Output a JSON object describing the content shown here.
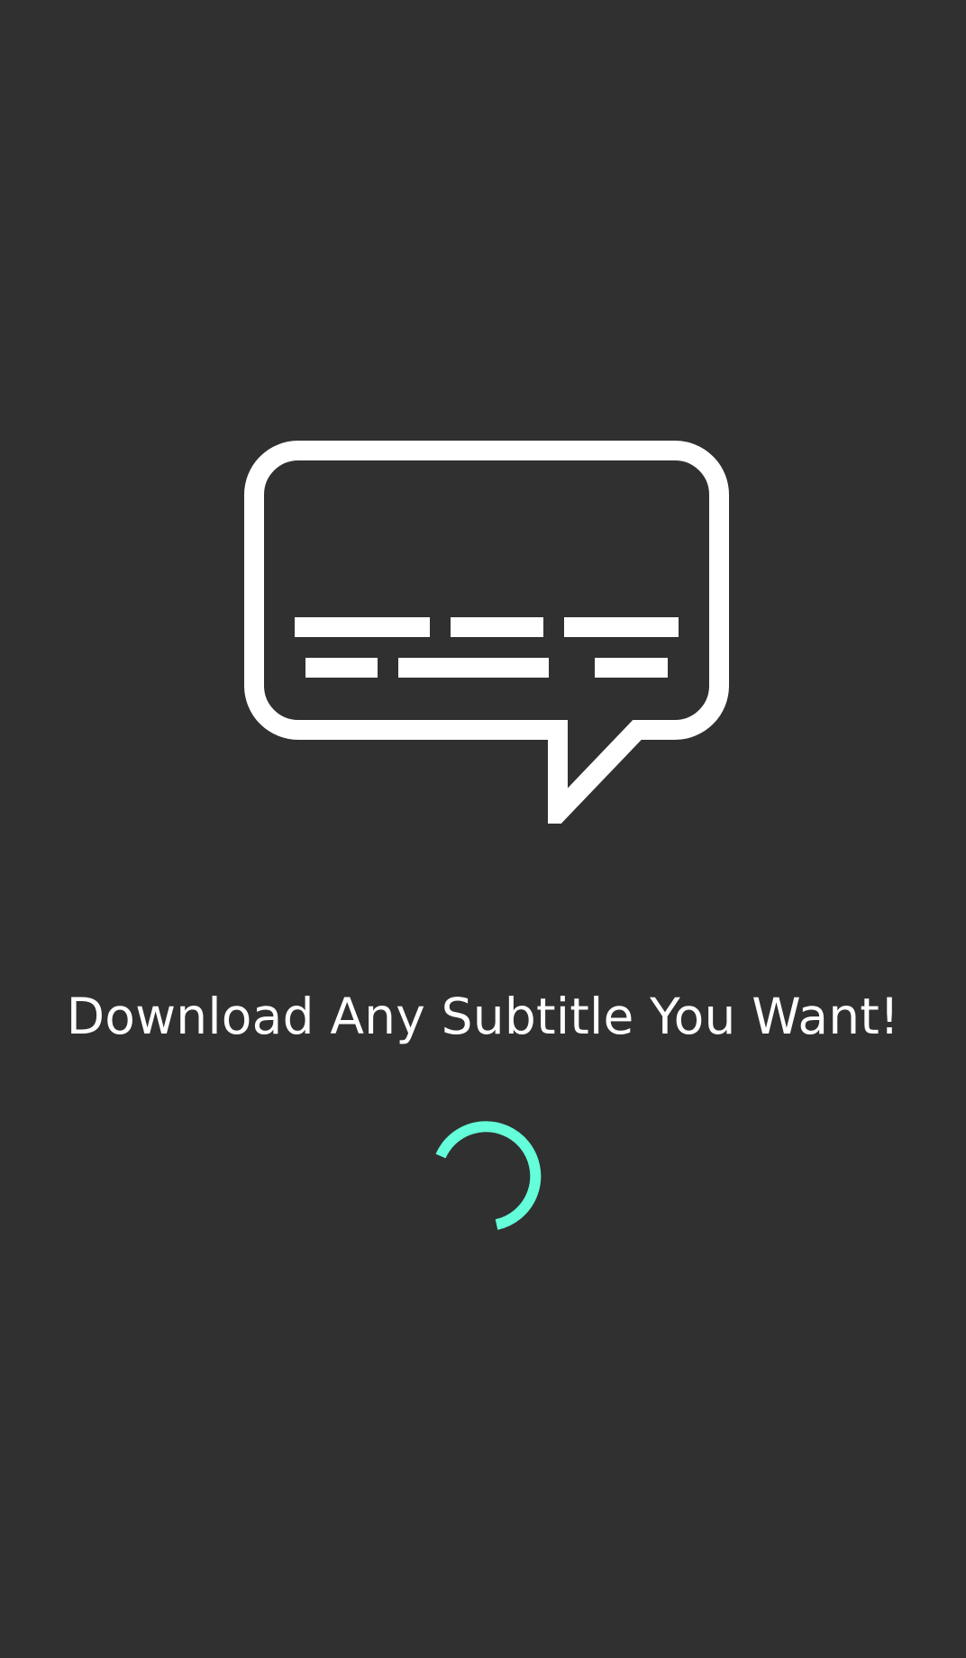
{
  "splash": {
    "tagline": "Download Any Subtitle You Want!",
    "logo_icon": "subtitle-speech-bubble-icon",
    "loading_indicator": "circular-progress-spinner"
  },
  "colors": {
    "background": "#303030",
    "foreground": "#ffffff",
    "accent": "#64FFDA"
  }
}
